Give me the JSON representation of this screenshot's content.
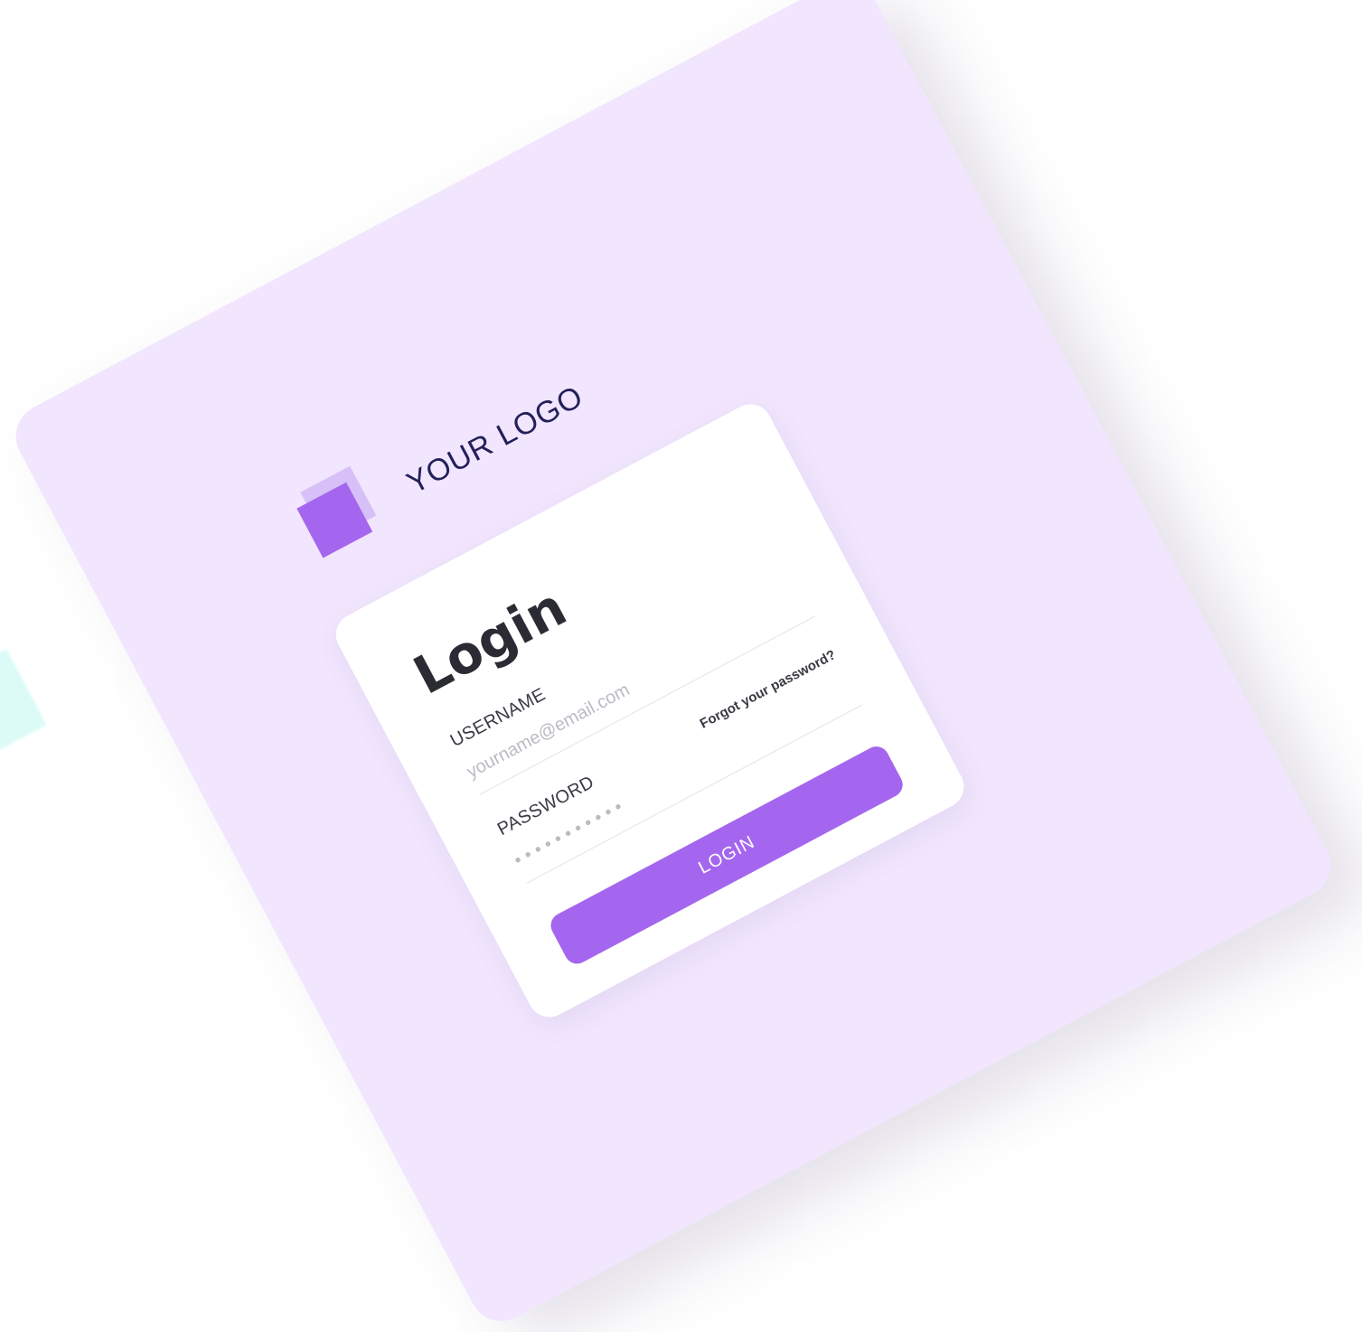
{
  "brand": {
    "logo_text": "YOUR LOGO"
  },
  "login": {
    "title": "Login",
    "username_label": "USERNAME",
    "username_placeholder": "yourname@email.com",
    "password_label": "PASSWORD",
    "password_placeholder": "• • • • • • • • • • •",
    "forgot_link": "Forgot your password?",
    "submit_label": "LOGIN"
  },
  "colors": {
    "accent": "#a466ee",
    "panel": "#f1e6fd",
    "accent_light": "#d7bff7",
    "text_dark": "#24205a"
  }
}
